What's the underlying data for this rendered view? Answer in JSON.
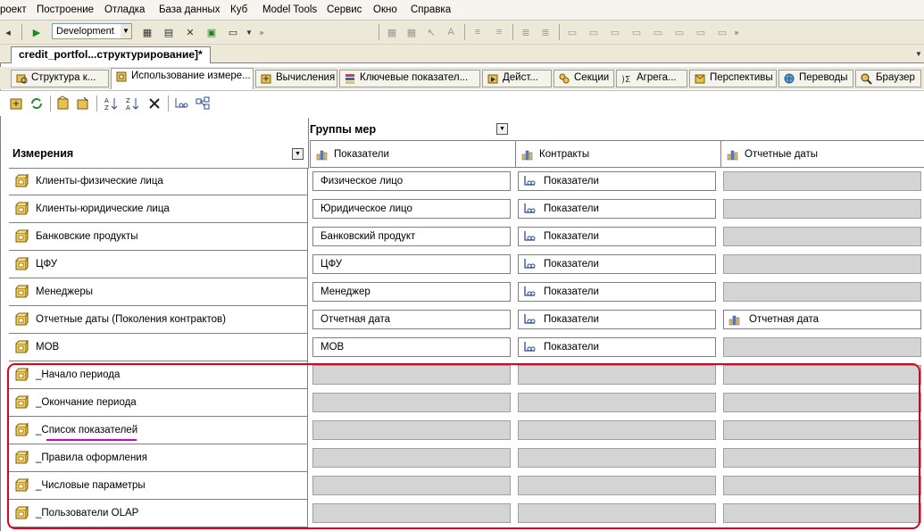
{
  "menu": [
    "роект",
    "Построение",
    "Отладка",
    "База данных",
    "Куб",
    "Model Tools",
    "Сервис",
    "Окно",
    "Справка"
  ],
  "toolbar": {
    "config_value": "Development"
  },
  "document_tab": "credit_portfol...структурирование]*",
  "designer_tabs": [
    "Структура к...",
    "Использование измере...",
    "Вычисления",
    "Ключевые показател...",
    "Дейст...",
    "Секции",
    "Агрега...",
    "Перспективы",
    "Переводы",
    "Браузер"
  ],
  "grid": {
    "measure_groups_label": "Группы мер",
    "dimensions_label": "Измерения",
    "measure_groups": [
      "Показатели",
      "Контракты",
      "Отчетные даты"
    ],
    "rows": [
      {
        "dimension": "Клиенты-физические лица",
        "cells": [
          "Физическое лицо",
          "Показатели",
          ""
        ]
      },
      {
        "dimension": "Клиенты-юридические лица",
        "cells": [
          "Юридическое лицо",
          "Показатели",
          ""
        ]
      },
      {
        "dimension": "Банковские продукты",
        "cells": [
          "Банковский продукт",
          "Показатели",
          ""
        ]
      },
      {
        "dimension": "ЦФУ",
        "cells": [
          "ЦФУ",
          "Показатели",
          ""
        ]
      },
      {
        "dimension": "Менеджеры",
        "cells": [
          "Менеджер",
          "Показатели",
          ""
        ]
      },
      {
        "dimension": "Отчетные даты (Поколения контрактов)",
        "cells": [
          "Отчетная дата",
          "Показатели",
          "Отчетная дата"
        ]
      },
      {
        "dimension": "MOB",
        "cells": [
          "MOB",
          "Показатели",
          ""
        ]
      },
      {
        "dimension": "_Начало периода",
        "cells": [
          "",
          "",
          ""
        ]
      },
      {
        "dimension": "_Окончание периода",
        "cells": [
          "",
          "",
          ""
        ]
      },
      {
        "dimension": "_Список показателей",
        "cells": [
          "",
          "",
          ""
        ]
      },
      {
        "dimension": "_Правила оформления",
        "cells": [
          "",
          "",
          ""
        ]
      },
      {
        "dimension": "_Числовые параметры",
        "cells": [
          "",
          "",
          ""
        ]
      },
      {
        "dimension": "_Пользователи OLAP",
        "cells": [
          "",
          "",
          ""
        ]
      }
    ]
  },
  "colors": {
    "highlight_frame": "#e3001b",
    "underline": "#d000c8"
  }
}
